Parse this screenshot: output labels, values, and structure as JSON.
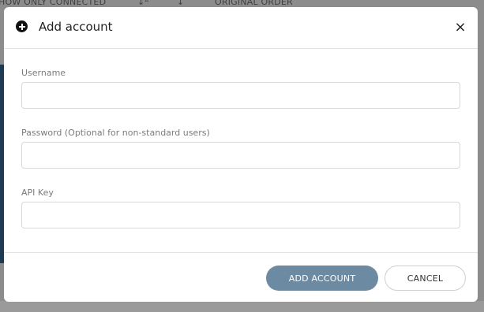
{
  "background": {
    "toolbar_items": [
      "HOW ONLY CONNECTED",
      "↓ᴬ",
      "↓",
      "ORIGINAL ORDER"
    ]
  },
  "modal": {
    "title": "Add account",
    "header_icon": "plus-circle-icon",
    "close_glyph": "×",
    "fields": [
      {
        "label": "Username",
        "value": "",
        "placeholder": ""
      },
      {
        "label": "Password (Optional for non-standard users)",
        "value": "",
        "placeholder": ""
      },
      {
        "label": "API Key",
        "value": "",
        "placeholder": ""
      }
    ],
    "buttons": {
      "primary_label": "ADD ACCOUNT",
      "secondary_label": "CANCEL"
    },
    "colors": {
      "primary_button": "#6d8aa3",
      "overlay": "#8c8c8c"
    }
  }
}
